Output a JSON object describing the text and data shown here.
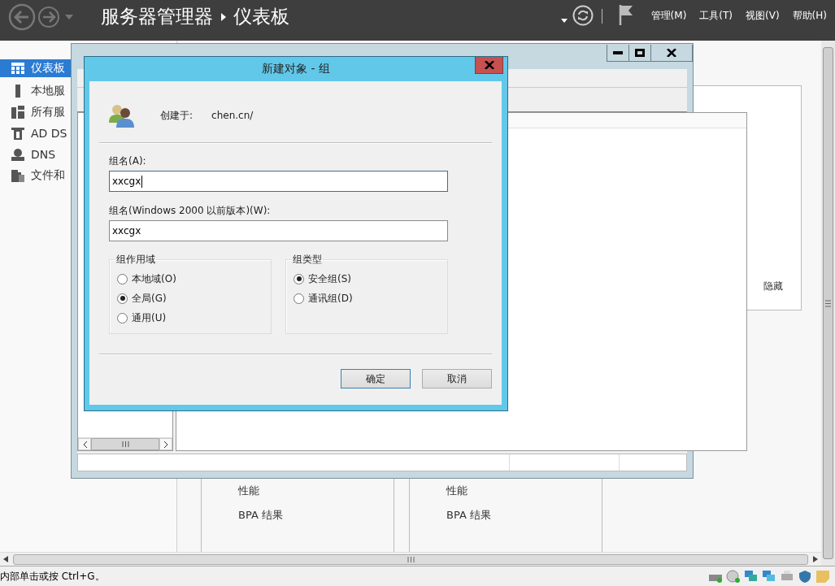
{
  "top_bar": {
    "title": "服务器管理器",
    "page": "仪表板",
    "menus": [
      "管理(M)",
      "工具(T)",
      "视图(V)",
      "帮助(H)"
    ]
  },
  "sidebar": {
    "items": [
      {
        "label": "仪表板",
        "selected": true
      },
      {
        "label": "本地服",
        "selected": false
      },
      {
        "label": "所有服",
        "selected": false
      },
      {
        "label": "AD DS",
        "selected": false
      },
      {
        "label": "DNS",
        "selected": false
      },
      {
        "label": "文件和",
        "selected": false
      }
    ]
  },
  "dashboard": {
    "hide_link": "隐藏",
    "tiles": [
      {
        "rows": [
          "性能",
          "BPA 结果"
        ]
      },
      {
        "rows": [
          "性能",
          "BPA 结果"
        ]
      }
    ]
  },
  "status_bar": {
    "text": "内部单击或按 Ctrl+G。"
  },
  "dialog": {
    "title": "新建对象 - 组",
    "created_in_label": "创建于:",
    "created_in": "chen.cn/",
    "fields": [
      {
        "label": "组名(A):",
        "value": "xxcgx",
        "focused": true
      },
      {
        "label": "组名(Windows 2000 以前版本)(W):",
        "value": "xxcgx",
        "focused": false
      }
    ],
    "groups": [
      {
        "title": "组作用域",
        "options": [
          {
            "label": "本地域(O)",
            "selected": false
          },
          {
            "label": "全局(G)",
            "selected": true
          },
          {
            "label": "通用(U)",
            "selected": false
          }
        ]
      },
      {
        "title": "组类型",
        "options": [
          {
            "label": "安全组(S)",
            "selected": true
          },
          {
            "label": "通讯组(D)",
            "selected": false
          }
        ]
      }
    ],
    "buttons": [
      {
        "label": "确定",
        "default": true
      },
      {
        "label": "取消",
        "default": false
      }
    ]
  }
}
